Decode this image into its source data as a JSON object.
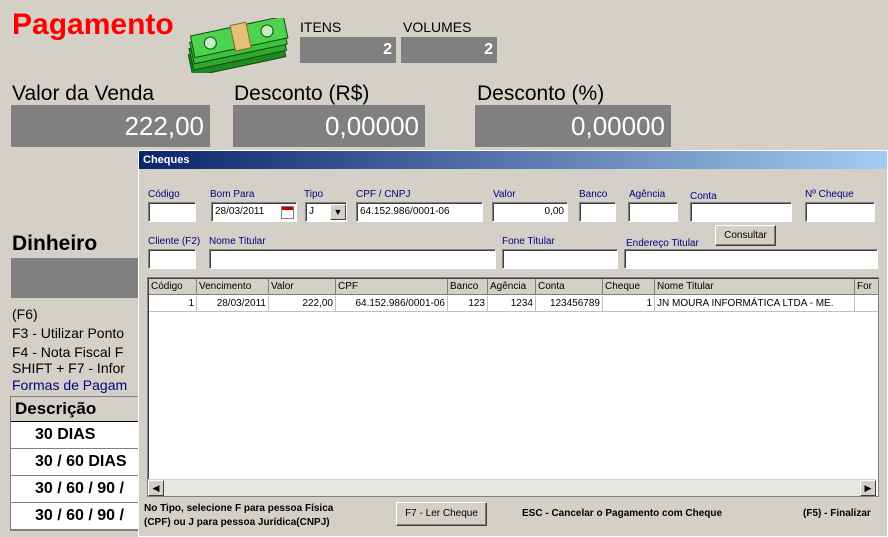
{
  "main": {
    "title": "Pagamento",
    "itens_label": "ITENS",
    "itens_value": "2",
    "volumes_label": "VOLUMES",
    "volumes_value": "2",
    "valor_venda_label": "Valor da Venda",
    "valor_venda_value": "222,00",
    "desconto_rs_label": "Desconto (R$)",
    "desconto_rs_value": "0,00000",
    "desconto_pct_label": "Desconto (%)",
    "desconto_pct_value": "0,00000",
    "dinheiro_label": "Dinheiro",
    "f6": "(F6)",
    "f3": "F3 - Utilizar Ponto",
    "f4": "F4 - Nota Fiscal F",
    "shift_f7": "SHIFT + F7 - Infor",
    "formas": "Formas de Pagam",
    "desc_header": "Descrição",
    "desc_rows": [
      "30 DIAS",
      "30 / 60 DIAS",
      "30 / 60 / 90 /",
      "30 / 60 / 90 /"
    ]
  },
  "dialog": {
    "title": "Cheques",
    "labels": {
      "codigo": "Código",
      "bom_para": "Bom Para",
      "tipo": "Tipo",
      "cpf_cnpj": "CPF / CNPJ",
      "valor": "Valor",
      "banco": "Banco",
      "agencia": "Agência",
      "conta": "Conta",
      "nro_cheque": "Nº Cheque",
      "cliente": "Cliente (F2)",
      "nome_titular": "Nome Titular",
      "fone_titular": "Fone Titular",
      "endereco_titular": "Endereço Titular"
    },
    "values": {
      "codigo": "",
      "bom_para": "28/03/2011",
      "tipo": "J",
      "cpf_cnpj": "64.152.986/0001-06",
      "valor": "0,00",
      "banco": "",
      "agencia": "",
      "conta": "",
      "nro_cheque": "",
      "cliente": "",
      "nome_titular": "",
      "fone_titular": "",
      "endereco_titular": ""
    },
    "consultar_label": "Consultar",
    "grid": {
      "headers": [
        "Código",
        "Vencimento",
        "Valor",
        "CPF",
        "Banco",
        "Agência",
        "Conta",
        "Cheque",
        "Nome Titular",
        "For"
      ],
      "row": [
        "1",
        "28/03/2011",
        "222,00",
        "64.152.986/0001-06",
        "123",
        "1234",
        "123456789",
        "1",
        "JN MOURA INFORMÁTICA LTDA - ME.",
        ""
      ]
    },
    "footer": {
      "tipo_hint_1": "No Tipo, selecione F para pessoa Física",
      "tipo_hint_2": "(CPF) ou J para pessoa Jurídica(CNPJ)",
      "ler_cheque": "F7 - Ler Cheque",
      "esc": "ESC - Cancelar o Pagamento com Cheque",
      "finalizar": "(F5) - Finalizar"
    }
  },
  "icons": [
    "money-icon",
    "calendar-icon",
    "dropdown-arrow-icon",
    "scroll-left-icon",
    "scroll-right-icon"
  ]
}
